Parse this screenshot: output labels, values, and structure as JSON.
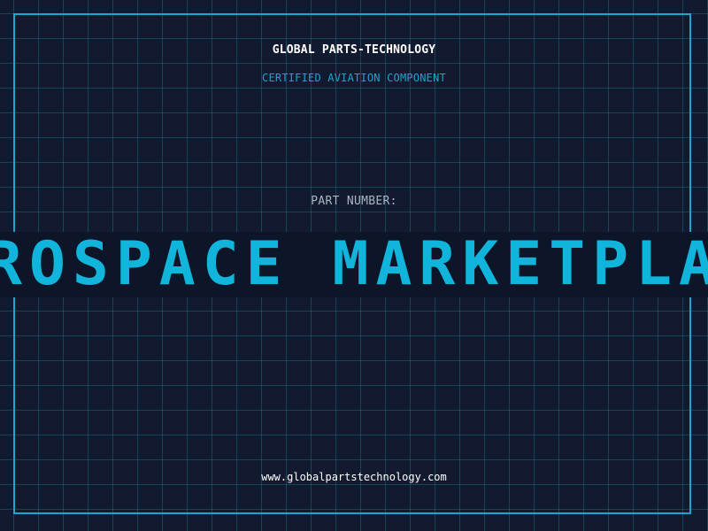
{
  "card": {
    "company": "GLOBAL PARTS-TECHNOLOGY",
    "subtitle": "CERTIFIED AVIATION COMPONENT",
    "part_label": "PART NUMBER:",
    "part_value": "AEROSPACE MARKETPLACE",
    "website": "www.globalpartstechnology.com"
  },
  "colors": {
    "background": "#111a2e",
    "grid": "#1e7896",
    "frame": "#1aa8d0",
    "accent": "#11b5dc",
    "banner_background": "#0d1628"
  }
}
